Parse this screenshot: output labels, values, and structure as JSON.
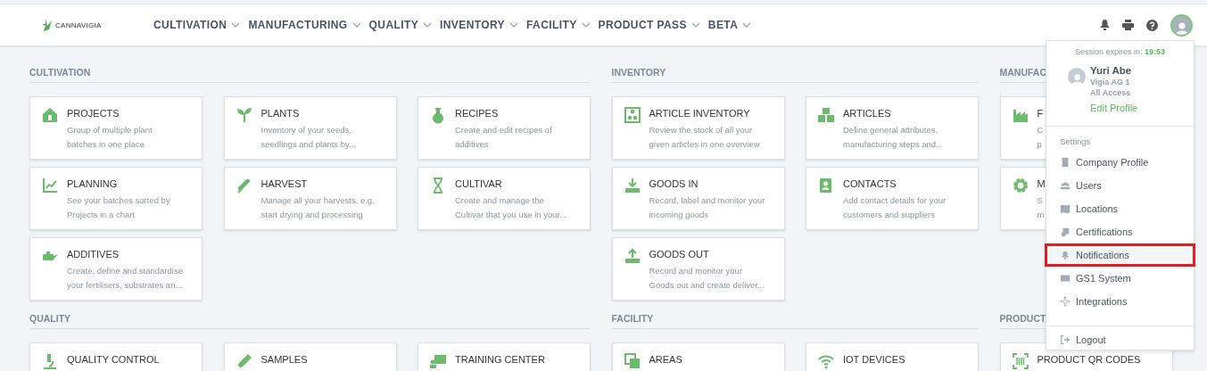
{
  "header": {
    "logo": "CANNAVIGIA",
    "nav": [
      {
        "label": "CULTIVATION"
      },
      {
        "label": "MANUFACTURING"
      },
      {
        "label": "QUALITY"
      },
      {
        "label": "INVENTORY"
      },
      {
        "label": "FACILITY"
      },
      {
        "label": "PRODUCT PASS"
      },
      {
        "label": "BETA"
      }
    ]
  },
  "sections": [
    {
      "title": "CULTIVATION",
      "cards": [
        {
          "title": "PROJECTS",
          "description": [
            "Group of multiple plant",
            "batches in one place"
          ]
        },
        {
          "title": "PLANTS",
          "description": [
            "Inventory of your seeds,",
            "seedlings and plants by..."
          ]
        },
        {
          "title": "RECIPES",
          "description": [
            "Create and edit recipes of",
            "additives"
          ]
        },
        {
          "title": "PLANNING",
          "description": [
            "See your batches sorted by",
            "Projects in a chart"
          ]
        },
        {
          "title": "HARVEST",
          "description": [
            "Manage all your harvests, e.g.",
            "start drying and processing"
          ]
        },
        {
          "title": "CULTIVAR",
          "description": [
            "Create and manage the",
            "Cultivar that you use in your..."
          ]
        },
        {
          "title": "ADDITIVES",
          "description": [
            "Create, define and standardise",
            "your fertilisers, substrates an..."
          ]
        }
      ]
    },
    {
      "title": "INVENTORY",
      "cards": [
        {
          "title": "ARTICLE INVENTORY",
          "description": [
            "Review the stock of all your",
            "given articles in one overview"
          ]
        },
        {
          "title": "ARTICLES",
          "description": [
            "Define general attributes,",
            "manufacturing steps and..."
          ]
        },
        {
          "title": "GOODS IN",
          "description": [
            "Record, label and monitor your",
            "incoming goods"
          ]
        },
        {
          "title": "CONTACTS",
          "description": [
            "Add contact details for your",
            "customers and suppliers"
          ]
        },
        {
          "title": "GOODS OUT",
          "description": [
            "Record and monitor your",
            "Goods out and create deliver..."
          ]
        }
      ]
    },
    {
      "title": "MANUFAC",
      "cards": [
        {
          "title": "F",
          "description": [
            "C",
            "p"
          ]
        },
        {
          "title": "M",
          "description": [
            "S",
            "m"
          ]
        }
      ]
    },
    {
      "title": "QUALITY",
      "cards": [
        {
          "title": "QUALITY CONTROL"
        },
        {
          "title": "SAMPLES"
        },
        {
          "title": "TRAINING CENTER"
        }
      ]
    },
    {
      "title": "FACILITY",
      "cards": [
        {
          "title": "AREAS"
        },
        {
          "title": "IOT DEVICES"
        }
      ]
    },
    {
      "title": "PRODUCT",
      "cards": [
        {
          "title": "PRODUCT QR CODES"
        }
      ]
    }
  ],
  "account_menu": {
    "session_label": "Session expires in:",
    "session_time": "19:53",
    "user_name": "Yuri Abe",
    "company": "Vigia AG 1",
    "role": "All Access",
    "edit_link": "Edit Profile",
    "settings_heading": "Settings",
    "items": [
      {
        "label": "Company Profile",
        "highlighted": false
      },
      {
        "label": "Users",
        "highlighted": false
      },
      {
        "label": "Locations",
        "highlighted": false
      },
      {
        "label": "Certifications",
        "highlighted": false
      },
      {
        "label": "Notifications",
        "highlighted": true
      },
      {
        "label": "GS1 System",
        "highlighted": false
      },
      {
        "label": "Integrations",
        "highlighted": false
      }
    ],
    "logout": "Logout"
  }
}
